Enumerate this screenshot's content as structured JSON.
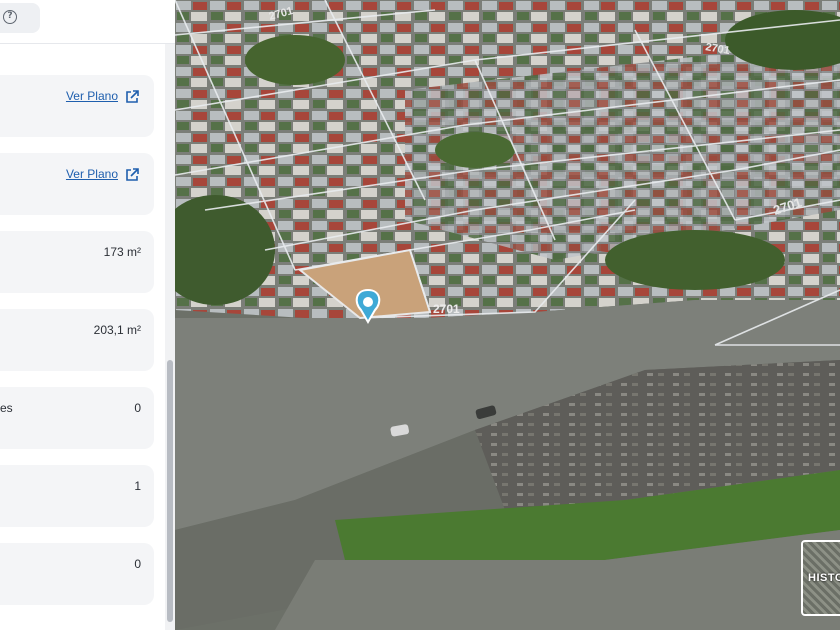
{
  "panel": {
    "help_icon": "question-circle-icon",
    "cards": [
      {
        "type": "link",
        "text": "Ver Plano",
        "icon": "external-link-icon"
      },
      {
        "type": "link",
        "text": "Ver Plano",
        "icon": "external-link-icon"
      },
      {
        "type": "value",
        "label": "",
        "value": "173 m²"
      },
      {
        "type": "value",
        "label": "",
        "value": "203,1 m²"
      },
      {
        "type": "value",
        "label": "es",
        "value": "0"
      },
      {
        "type": "value",
        "label": "",
        "value": "1"
      },
      {
        "type": "value",
        "label": "",
        "value": "0"
      }
    ]
  },
  "map": {
    "street_labels": [
      "2701",
      "2701",
      "2701"
    ],
    "lot_label": "2701",
    "marker_icon": "map-pin-icon",
    "marker_color": "#3fa9d6",
    "history_button": "HISTO"
  },
  "colors": {
    "link": "#1f5fae",
    "card_bg": "#f4f5f7",
    "vegetation": "#3f5b2e",
    "lot": "#c9a27a"
  }
}
